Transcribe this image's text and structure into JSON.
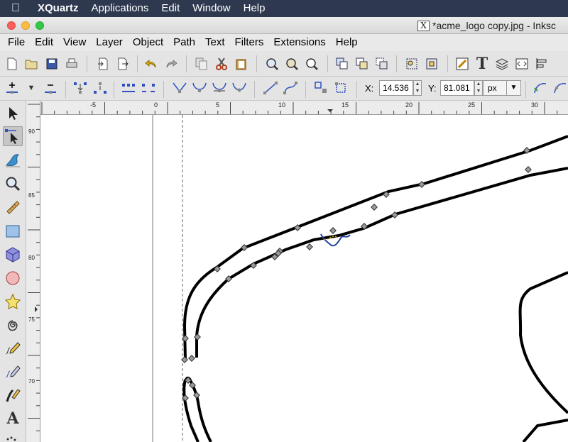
{
  "mac_menubar": {
    "items": [
      "XQuartz",
      "Applications",
      "Edit",
      "Window",
      "Help"
    ]
  },
  "window": {
    "title": "*acme_logo copy.jpg - Inksc"
  },
  "menu": {
    "items": [
      "File",
      "Edit",
      "View",
      "Layer",
      "Object",
      "Path",
      "Text",
      "Filters",
      "Extensions",
      "Help"
    ]
  },
  "coords": {
    "x_label": "X:",
    "x_value": "14.536",
    "y_label": "Y:",
    "y_value": "81.081",
    "unit": "px"
  },
  "ruler": {
    "h_labels": [
      "-5",
      "0",
      "5",
      "10",
      "15",
      "20",
      "25",
      "30"
    ],
    "v_labels": [
      "90",
      "85",
      "80",
      "75",
      "70"
    ]
  },
  "colors": {
    "mac_menubar": "#2e3950",
    "toolbar": "#e4e4e4",
    "canvas": "#ffffff",
    "path_stroke": "#000000",
    "node": "#9a9a9a"
  },
  "icons": {
    "tools": [
      "selector-arrow-icon",
      "node-editor-icon",
      "tweak-icon",
      "zoom-icon",
      "measure-icon",
      "rectangle-icon",
      "3d-box-icon",
      "ellipse-icon",
      "star-icon",
      "spiral-icon",
      "pencil-icon",
      "pen-icon",
      "calligraphy-icon",
      "text-icon",
      "spray-icon"
    ]
  }
}
